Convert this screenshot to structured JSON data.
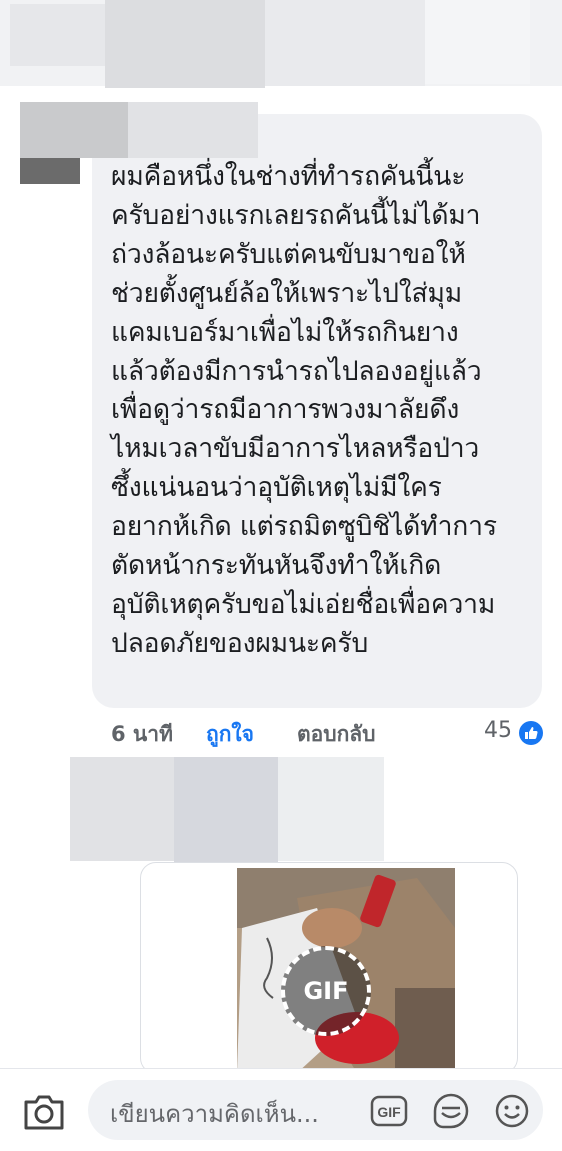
{
  "comment": {
    "text": "ผมคือหนึ่งในช่างที่ทำรถคันนี้นะ\nครับอย่างแรกเลยรถคันนี้ไม่ได้มา\nถ่วงล้อนะครับแต่คนขับมาขอให้\nช่วยตั้งศูนย์ล้อให้เพราะไปใส่มุม\nแคมเบอร์มาเพื่อไม่ให้รถกินยาง\nแล้วต้องมีการนำรถไปลองอยู่แล้ว\nเพื่อดูว่ารถมีอาการพวงมาลัยดึง\nไหมเวลาขับมีอาการไหลหรือป่าว\nซึ้งแน่นอนว่าอุบัติเหตุไม่มีใคร\nอยากห้เกิด แต่รถมิตซูบิชิได้ทำการ\nตัดหน้ากระทันหันจึงทำให้เกิด\nอุบัติเหตุครับขอไม่เอ่ยชื่อเพื่อความ\nปลอดภัยของผมนะครับ",
    "time": "6 นาที",
    "like_label": "ถูกใจ",
    "reply_label": "ตอบกลับ",
    "reaction_count": "45"
  },
  "gif_reply": {
    "badge": "GIF"
  },
  "composer": {
    "placeholder": "เขียนความคิดเห็น...",
    "gif_label": "GIF"
  },
  "colors": {
    "accent": "#1877f2",
    "bubble": "#f0f1f4",
    "muted": "#65676b"
  },
  "icons": [
    "camera-icon",
    "gif-icon",
    "sticker-icon",
    "emoji-icon",
    "like-thumb-icon"
  ]
}
